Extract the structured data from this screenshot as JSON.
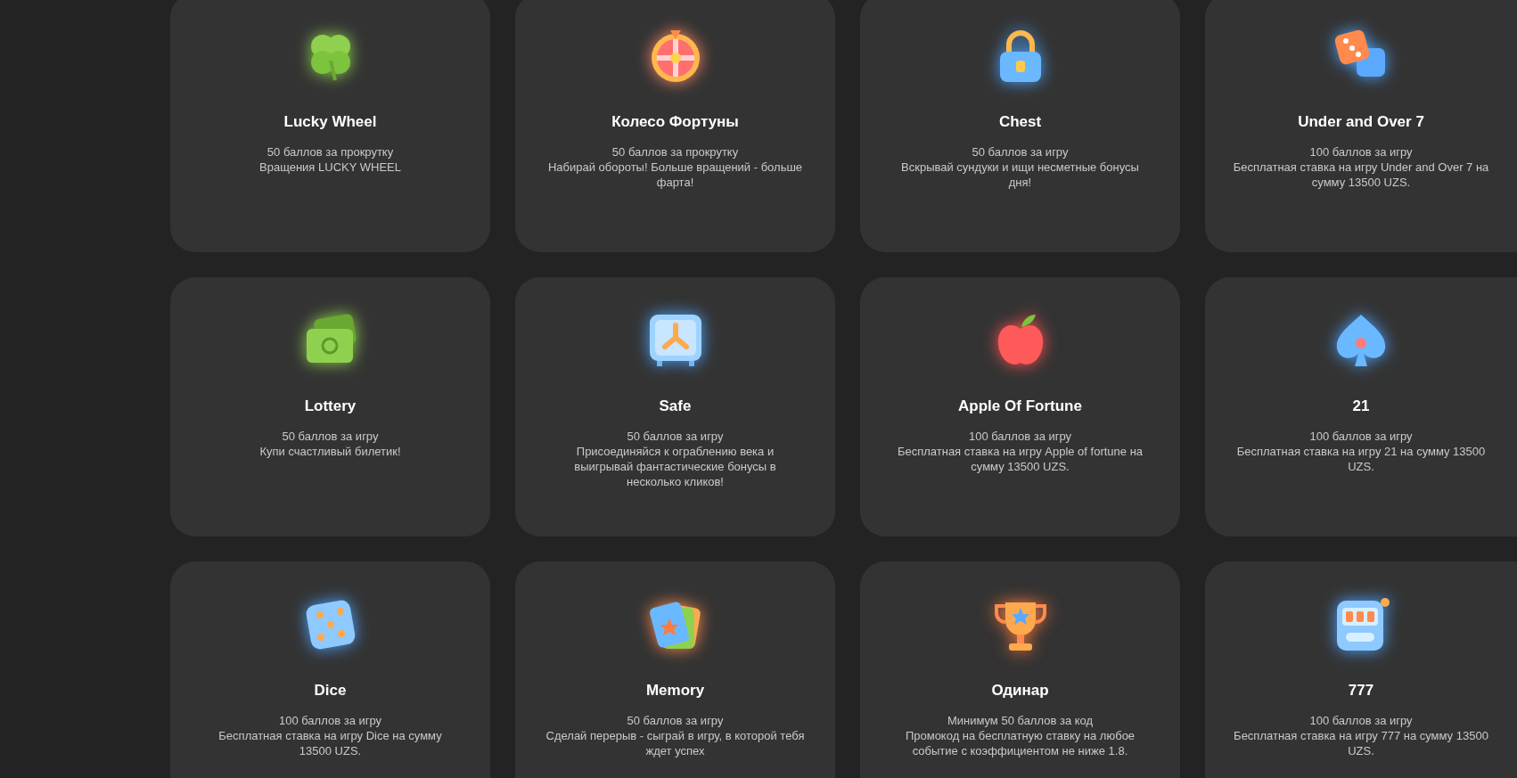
{
  "games": [
    {
      "title": "Lucky Wheel",
      "points": "50 баллов за прокрутку",
      "description": "Вращения LUCKY WHEEL"
    },
    {
      "title": "Колесо Фортуны",
      "points": "50 баллов за прокрутку",
      "description": "Набирай обороты! Больше вращений - больше фарта!"
    },
    {
      "title": "Chest",
      "points": "50 баллов за игру",
      "description": "Вскрывай сундуки и ищи несметные бонусы дня!"
    },
    {
      "title": "Under and Over 7",
      "points": "100 баллов за игру",
      "description": "Бесплатная ставка на игру Under and Over 7 на сумму 13500 UZS."
    },
    {
      "title": "Lottery",
      "points": "50 баллов за игру",
      "description": "Купи счастливый билетик!"
    },
    {
      "title": "Safe",
      "points": "50 баллов за игру",
      "description": "Присоединяйся к ограблению века и выигрывай фантастические бонусы в несколько кликов!"
    },
    {
      "title": "Apple Of Fortune",
      "points": "100 баллов за игру",
      "description": "Бесплатная ставка на игру Apple of fortune на сумму 13500 UZS."
    },
    {
      "title": "21",
      "points": "100 баллов за игру",
      "description": "Бесплатная ставка на игру 21 на сумму 13500 UZS."
    },
    {
      "title": "Dice",
      "points": "100 баллов за игру",
      "description": "Бесплатная ставка на игру Dice на сумму 13500 UZS."
    },
    {
      "title": "Memory",
      "points": "50 баллов за игру",
      "description": "Сделай перерыв - сыграй в игру, в которой тебя ждет успех"
    },
    {
      "title": "Одинар",
      "points": "Минимум 50 баллов за код",
      "description": "Промокод на бесплатную ставку на любое событие с коэффициентом не ниже 1.8."
    },
    {
      "title": "777",
      "points": "100 баллов за игру",
      "description": "Бесплатная ставка на игру 777 на сумму 13500 UZS."
    }
  ]
}
